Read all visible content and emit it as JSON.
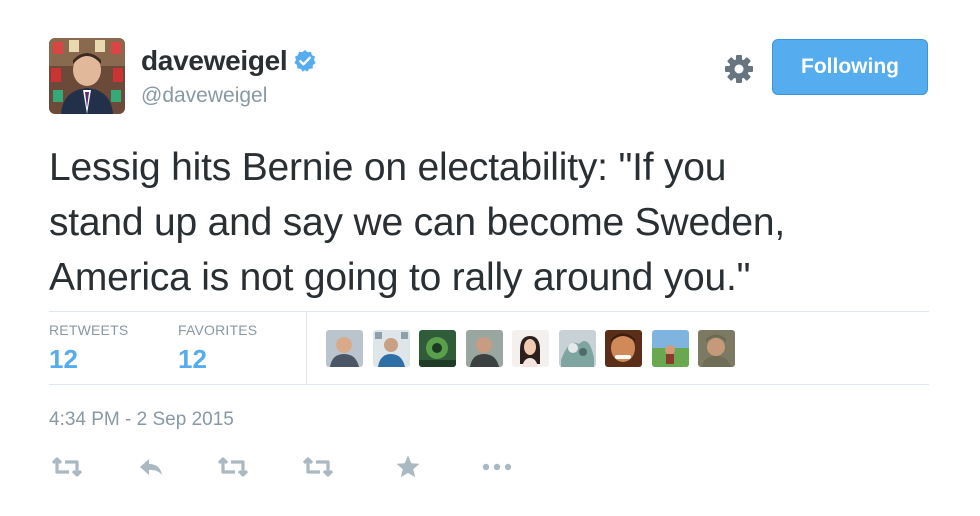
{
  "user": {
    "display_name": "daveweigel",
    "handle": "@daveweigel",
    "verified": true,
    "avatar_icon": "profile-photo"
  },
  "header": {
    "follow_button_label": "Following",
    "settings_icon": "gear-icon"
  },
  "tweet": {
    "text_lines": [
      "Lessig hits Bernie on electability: \"If you",
      "stand up and say we can become Sweden,",
      "America is not going to rally around you.\""
    ],
    "timestamp": "4:34 PM - 2 Sep 2015"
  },
  "stats": {
    "retweets_label": "RETWEETS",
    "retweets_count": "12",
    "favorites_label": "FAVORITES",
    "favorites_count": "12"
  },
  "favoriters": [
    {
      "icon": "user-avatar"
    },
    {
      "icon": "user-avatar"
    },
    {
      "icon": "user-avatar"
    },
    {
      "icon": "user-avatar"
    },
    {
      "icon": "user-avatar"
    },
    {
      "icon": "user-avatar"
    },
    {
      "icon": "user-avatar"
    },
    {
      "icon": "user-avatar"
    },
    {
      "icon": "user-avatar"
    }
  ],
  "actions": [
    {
      "icon": "retweet-icon"
    },
    {
      "icon": "reply-icon"
    },
    {
      "icon": "retweet-icon"
    },
    {
      "icon": "retweet-icon"
    },
    {
      "icon": "star-icon"
    },
    {
      "icon": "more-icon"
    }
  ],
  "colors": {
    "accent": "#55acee",
    "text": "#292f33",
    "muted": "#8899a6",
    "divider": "#e1e8ed",
    "action_icon": "#aab8c2"
  }
}
